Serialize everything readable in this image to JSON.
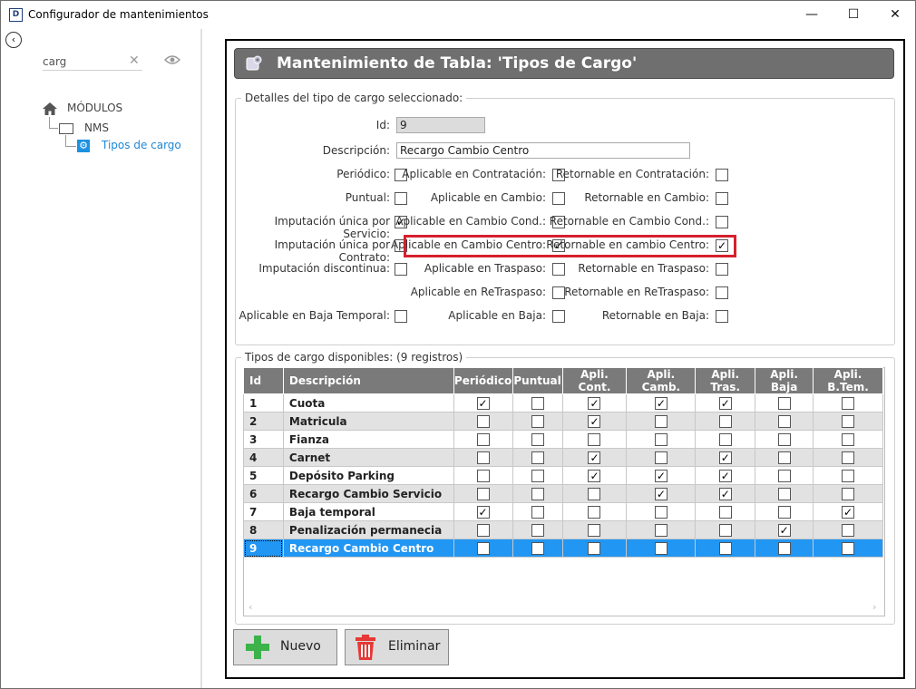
{
  "window": {
    "app_icon": "D",
    "title": "Configurador de mantenimientos",
    "minimize": "—",
    "maximize": "☐",
    "close": "✕"
  },
  "sidebar": {
    "back": "‹",
    "search_value": "carg",
    "clear": "✕",
    "tree": {
      "root": "MÓDULOS",
      "module": "NMS",
      "item": "Tipos de cargo"
    }
  },
  "panel": {
    "title": "Mantenimiento de Tabla: 'Tipos de Cargo'"
  },
  "details": {
    "legend": "Detalles del tipo de cargo seleccionado:",
    "id_label": "Id:",
    "id_value": "9",
    "desc_label": "Descripción:",
    "desc_value": "Recargo Cambio Centro",
    "col1": [
      {
        "label": "Periódico:",
        "checked": false
      },
      {
        "label": "Puntual:",
        "checked": false
      },
      {
        "label": "Imputación única por Servicio:",
        "checked": true
      },
      {
        "label": "Imputación única por Contrato:",
        "checked": false
      },
      {
        "label": "Imputación discontinua:",
        "checked": false
      },
      {
        "label": "Aplicable en Baja Temporal:",
        "checked": false
      }
    ],
    "col2": [
      {
        "label": "Aplicable en Contratación:",
        "checked": false
      },
      {
        "label": "Aplicable en Cambio:",
        "checked": false
      },
      {
        "label": "Aplicable en Cambio Cond.:",
        "checked": false
      },
      {
        "label": "Aplicable en Cambio Centro:",
        "checked": true
      },
      {
        "label": "Aplicable en Traspaso:",
        "checked": false
      },
      {
        "label": "Aplicable en ReTraspaso:",
        "checked": false
      },
      {
        "label": "Aplicable en Baja:",
        "checked": false
      }
    ],
    "col3": [
      {
        "label": "Retornable en Contratación:",
        "checked": false
      },
      {
        "label": "Retornable en Cambio:",
        "checked": false
      },
      {
        "label": "Retornable en Cambio Cond.:",
        "checked": false
      },
      {
        "label": "Retornable en cambio Centro:",
        "checked": true
      },
      {
        "label": "Retornable en Traspaso:",
        "checked": false
      },
      {
        "label": "Retornable en ReTraspaso:",
        "checked": false
      },
      {
        "label": "Retornable en Baja:",
        "checked": false
      }
    ]
  },
  "list": {
    "legend": "Tipos de cargo disponibles:  (9 registros)",
    "columns": [
      "Id",
      "Descripción",
      "Periódico",
      "Puntual",
      "Apli. Cont.",
      "Apli. Camb.",
      "Apli. Tras.",
      "Apli. Baja",
      "Apli. B.Tem."
    ],
    "rows": [
      {
        "id": "1",
        "desc": "Cuota",
        "flags": [
          true,
          false,
          true,
          true,
          true,
          false,
          false
        ]
      },
      {
        "id": "2",
        "desc": "Matricula",
        "flags": [
          false,
          false,
          true,
          false,
          false,
          false,
          false
        ]
      },
      {
        "id": "3",
        "desc": "Fianza",
        "flags": [
          false,
          false,
          false,
          false,
          false,
          false,
          false
        ]
      },
      {
        "id": "4",
        "desc": "Carnet",
        "flags": [
          false,
          false,
          true,
          false,
          true,
          false,
          false
        ]
      },
      {
        "id": "5",
        "desc": "Depósito Parking",
        "flags": [
          false,
          false,
          true,
          true,
          true,
          false,
          false
        ]
      },
      {
        "id": "6",
        "desc": "Recargo Cambio Servicio",
        "flags": [
          false,
          false,
          false,
          true,
          true,
          false,
          false
        ]
      },
      {
        "id": "7",
        "desc": "Baja temporal",
        "flags": [
          true,
          false,
          false,
          false,
          false,
          false,
          true
        ]
      },
      {
        "id": "8",
        "desc": "Penalización permanecia",
        "flags": [
          false,
          false,
          false,
          false,
          false,
          true,
          false
        ]
      },
      {
        "id": "9",
        "desc": "Recargo Cambio Centro",
        "flags": [
          false,
          false,
          false,
          false,
          false,
          false,
          false
        ]
      }
    ],
    "selected_row": "9",
    "scroll_left": "‹",
    "scroll_right": "›"
  },
  "buttons": {
    "new_label": "Nuevo",
    "delete_label": "Eliminar"
  },
  "colors": {
    "header_gray": "#6f6f6f",
    "selection_blue": "#2196f3",
    "highlight_red": "#d6202d",
    "add_green": "#3cb34a",
    "delete_red": "#e53935"
  }
}
